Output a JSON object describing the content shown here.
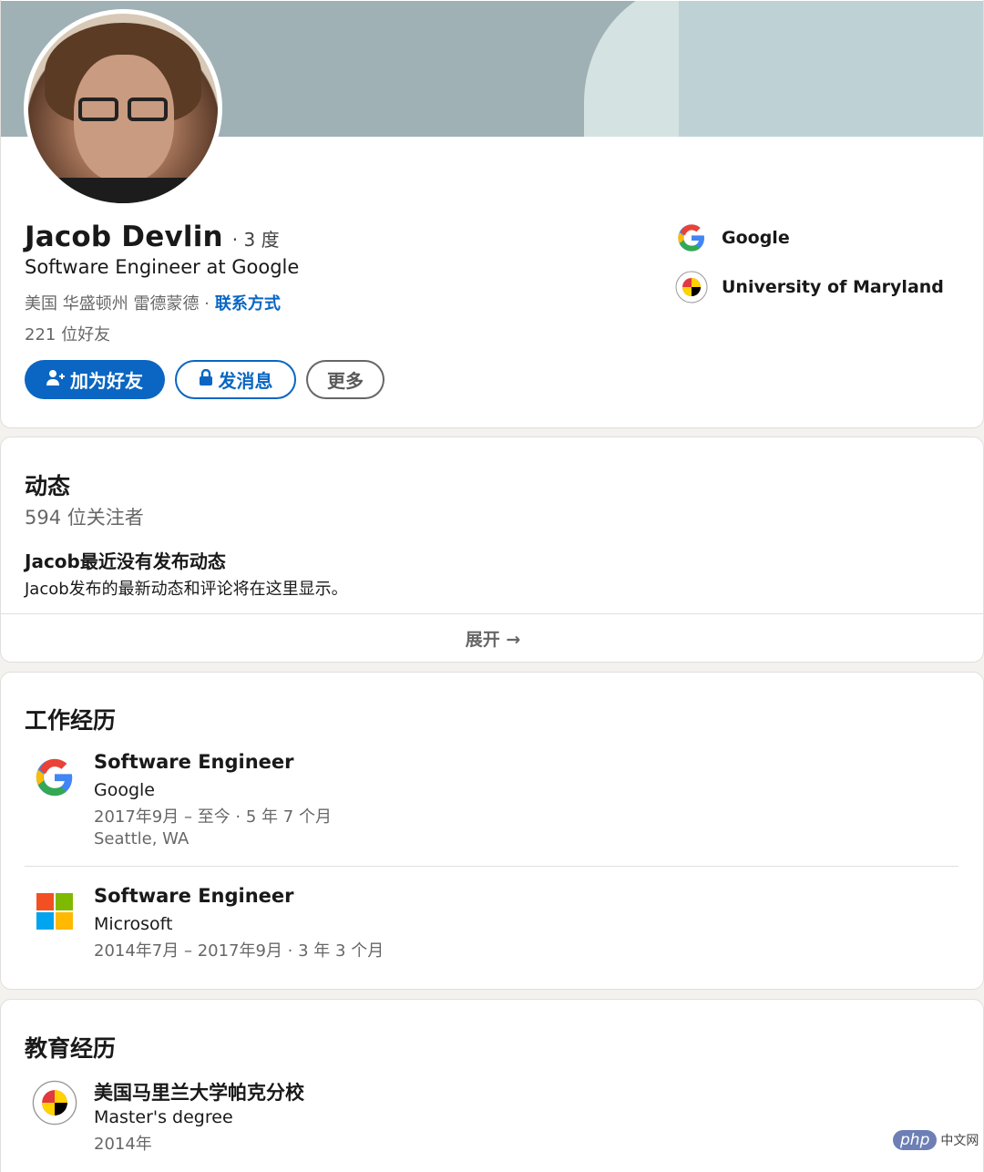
{
  "profile": {
    "name": "Jacob Devlin",
    "degree": "· 3 度",
    "headline": "Software Engineer at Google",
    "location": "美国 华盛顿州 雷德蒙德 ·",
    "contact_label": "联系方式",
    "connections": "221 位好友"
  },
  "actions": {
    "connect_label": "加为好友",
    "message_label": "发消息",
    "more_label": "更多"
  },
  "side_orgs": [
    {
      "name": "Google",
      "icon": "google-logo"
    },
    {
      "name": "University of Maryland",
      "icon": "umd-seal"
    }
  ],
  "activity": {
    "title": "动态",
    "followers": "594 位关注者",
    "empty_title": "Jacob最近没有发布动态",
    "empty_desc": "Jacob发布的最新动态和评论将在这里显示。",
    "expand_label": "展开 →"
  },
  "experience": {
    "title": "工作经历",
    "items": [
      {
        "title": "Software Engineer",
        "company": "Google",
        "dates": "2017年9月 – 至今 · 5 年 7 个月",
        "location": "Seattle, WA",
        "icon": "google-logo"
      },
      {
        "title": "Software Engineer",
        "company": "Microsoft",
        "dates": "2014年7月 – 2017年9月 · 3 年 3 个月",
        "icon": "microsoft-logo"
      }
    ]
  },
  "education": {
    "title": "教育经历",
    "items": [
      {
        "school": "美国马里兰大学帕克分校",
        "degree": "Master's degree",
        "year": "2014年",
        "icon": "umd-seal"
      }
    ]
  },
  "watermark": {
    "brand": "php",
    "site": "中文网"
  },
  "colors": {
    "accent": "#0a66c2",
    "banner": "#9fb1b5",
    "background": "#f3f2ef"
  }
}
